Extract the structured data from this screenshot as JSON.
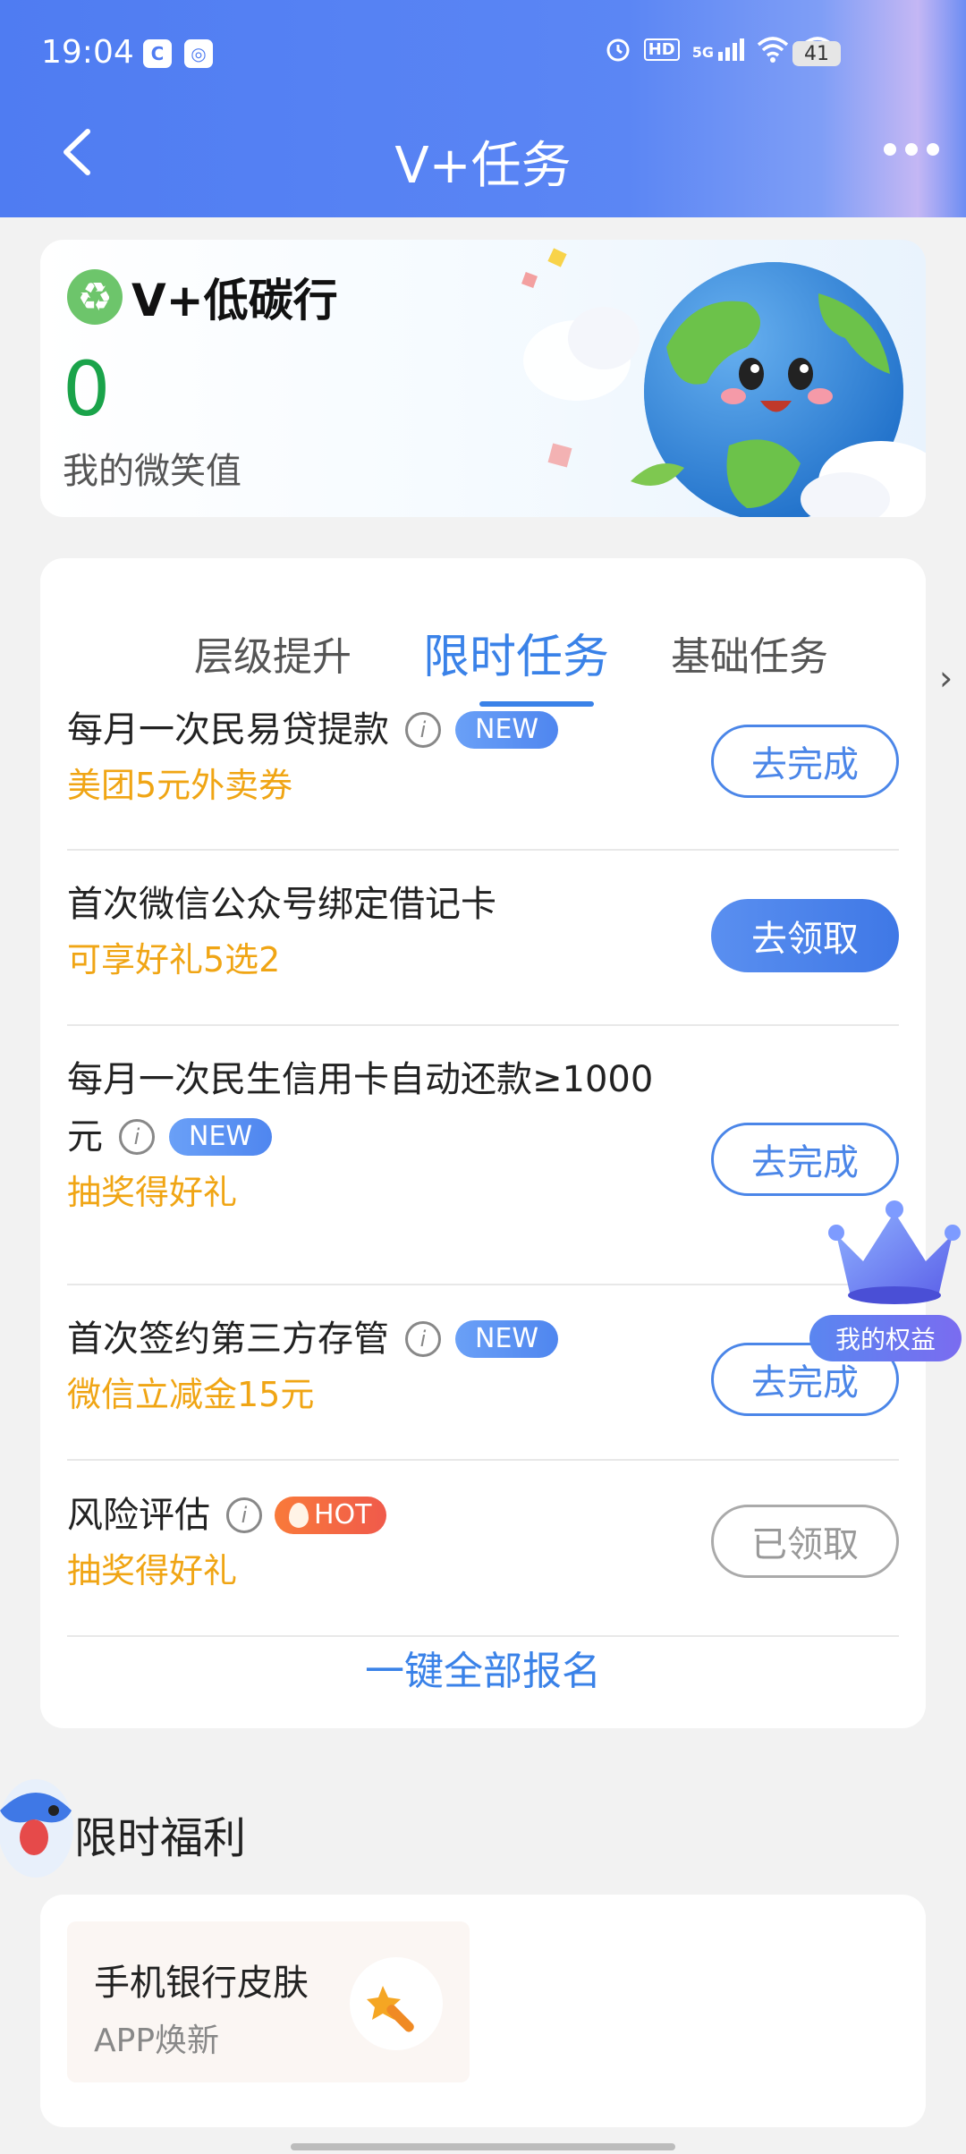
{
  "status_bar": {
    "time": "19:04",
    "network": "5G",
    "hd": "HD",
    "battery": "41",
    "left_icon_1": "C",
    "left_icon_2": "◎"
  },
  "header": {
    "title": "V+任务"
  },
  "banner": {
    "title": "V+低碳行",
    "recycle_icon": "♻",
    "smile_value": "0",
    "smile_label": "我的微笑值"
  },
  "tabs": [
    {
      "label": "层级提升",
      "active": false
    },
    {
      "label": "限时任务",
      "active": true
    },
    {
      "label": "基础任务",
      "active": false
    }
  ],
  "tasks": [
    {
      "title": "每月一次民易贷提款",
      "badge": "NEW",
      "reward": "美团5元外卖券",
      "button": "去完成",
      "style": "outline"
    },
    {
      "title": "首次微信公众号绑定借记卡",
      "badge": "",
      "reward": "可享好礼5选2",
      "button": "去领取",
      "style": "fill"
    },
    {
      "title_line1": "每月一次民生信用卡自动还款≥1000",
      "title_line2": "元",
      "badge": "NEW",
      "reward": "抽奖得好礼",
      "button": "去完成",
      "style": "outline"
    },
    {
      "title": "首次签约第三方存管",
      "badge": "NEW",
      "reward": "微信立减金15元",
      "button": "去完成",
      "style": "outline"
    },
    {
      "title": "风险评估",
      "badge": "HOT",
      "reward": "抽奖得好礼",
      "button": "已领取",
      "style": "gray"
    }
  ],
  "info_icon_glyph": "i",
  "signup_all": "一键全部报名",
  "floating": {
    "label": "我的权益"
  },
  "benefits": {
    "title": "限时福利",
    "item": {
      "title": "手机银行皮肤",
      "subtitle": "APP焕新"
    }
  },
  "colors": {
    "accent_blue": "#3a82e8",
    "reward_orange": "#f0a514",
    "smile_green": "#1aa34a"
  }
}
